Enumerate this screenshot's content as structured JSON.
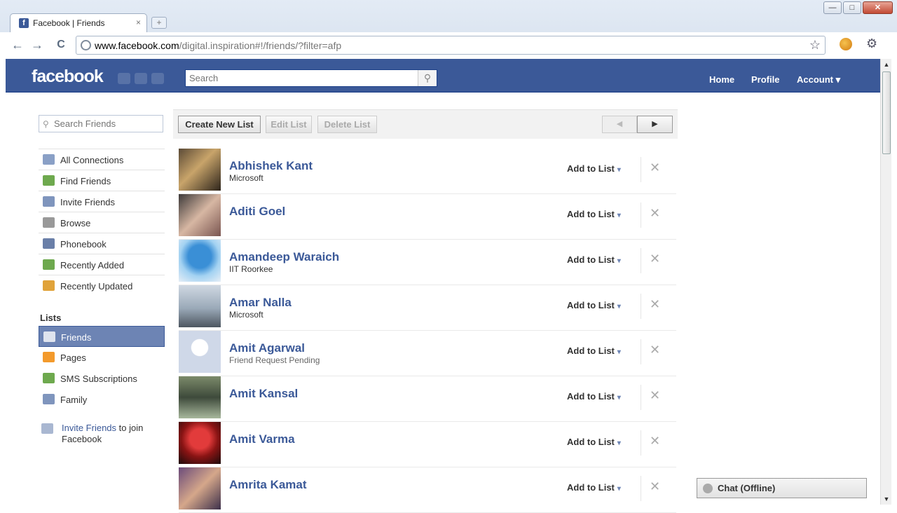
{
  "browser": {
    "tab_title": "Facebook | Friends",
    "tab_close": "×",
    "new_tab": "+",
    "win_min": "—",
    "win_max": "□",
    "win_close": "✕",
    "back": "←",
    "forward": "→",
    "reload": "C",
    "url_host": "www.facebook.com",
    "url_path": "/digital.inspiration#!/friends/?filter=afp",
    "star": "☆",
    "wrench": "⚙"
  },
  "header": {
    "logo": "facebook",
    "search_placeholder": "Search",
    "search_icon": "⚲",
    "nav_home": "Home",
    "nav_profile": "Profile",
    "nav_account": "Account ▾",
    "brand_color": "#3b5998"
  },
  "sidebar": {
    "search_placeholder": "Search Friends",
    "items": [
      {
        "label": "All Connections",
        "icon": "people-icon",
        "color": "#8aa0c6"
      },
      {
        "label": "Find Friends",
        "icon": "find-friends-icon",
        "color": "#6ea94e"
      },
      {
        "label": "Invite Friends",
        "icon": "invite-icon",
        "color": "#7f95bd"
      },
      {
        "label": "Browse",
        "icon": "magnifier-icon",
        "color": "#999999"
      },
      {
        "label": "Phonebook",
        "icon": "phone-icon",
        "color": "#6a7fa8"
      },
      {
        "label": "Recently Added",
        "icon": "recently-added-icon",
        "color": "#6ea94e"
      },
      {
        "label": "Recently Updated",
        "icon": "pencil-icon",
        "color": "#e0a33a"
      }
    ],
    "lists_heading": "Lists",
    "lists": [
      {
        "label": "Friends",
        "icon": "friends-list-icon",
        "color": "#dfe4ee",
        "active": true
      },
      {
        "label": "Pages",
        "icon": "pages-icon",
        "color": "#f39a2c",
        "active": false
      },
      {
        "label": "SMS Subscriptions",
        "icon": "sms-icon",
        "color": "#6ea94e",
        "active": false
      },
      {
        "label": "Family",
        "icon": "family-icon",
        "color": "#7f95bd",
        "active": false
      }
    ],
    "invite_link": "Invite Friends",
    "invite_rest": " to join Facebook"
  },
  "listbar": {
    "create": "Create New List",
    "edit": "Edit List",
    "delete": "Delete List",
    "prev": "◀",
    "next": "▶"
  },
  "friends": [
    {
      "name": "Abhishek Kant",
      "sub": "Microsoft",
      "add": "Add to List",
      "pic": "linear-gradient(135deg,#5b4a36,#c8a46a 45%,#2d241b)"
    },
    {
      "name": "Aditi Goel",
      "sub": "",
      "add": "Add to List",
      "pic": "linear-gradient(135deg,#3d3a3a,#d7b7a3 50%,#7a5550)"
    },
    {
      "name": "Amandeep Waraich",
      "sub": "IIT Roorkee",
      "add": "Add to List",
      "pic": "radial-gradient(circle at 50% 40%,#3a8fd6 35%,#a3d2f2 60%,#e6eef6)"
    },
    {
      "name": "Amar Nalla",
      "sub": "Microsoft",
      "add": "Add to List",
      "pic": "linear-gradient(180deg,#cfd8e2,#9aa9b8 55%,#4d5660)"
    },
    {
      "name": "Amit Agarwal",
      "sub": "Friend Request Pending",
      "add": "Add to List",
      "pic": "radial-gradient(circle at 50% 40%,#ffffff 25%,#cfd8e8 27%,#cfd8e8)"
    },
    {
      "name": "Amit Kansal",
      "sub": "",
      "add": "Add to List",
      "pic": "linear-gradient(180deg,#7b8a6a,#3e4a3b 50%,#a7b79c)"
    },
    {
      "name": "Amit Varma",
      "sub": "",
      "add": "Add to List",
      "pic": "radial-gradient(circle at 50% 40%,#e23b3b 30%,#8a1414 55%,#1a0b0b)"
    },
    {
      "name": "Amrita Kamat",
      "sub": "",
      "add": "Add to List",
      "pic": "linear-gradient(135deg,#6b4b7a,#d5a78a 50%,#3c2f4a)"
    }
  ],
  "row_close": "✕",
  "row_caret": "▾",
  "chat": "Chat (Offline)"
}
